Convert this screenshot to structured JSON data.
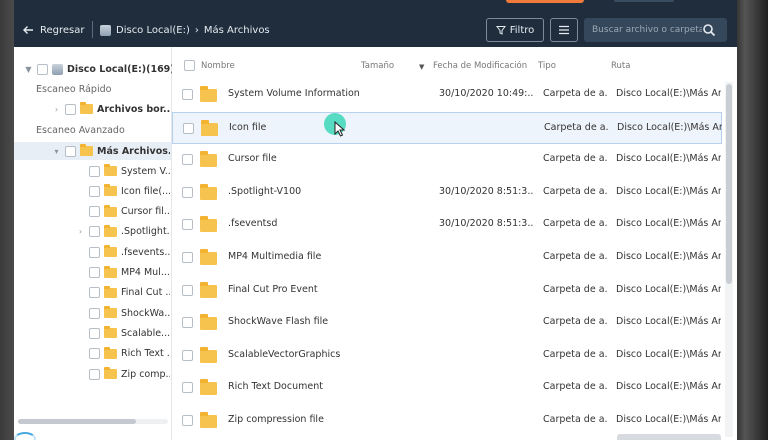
{
  "header": {
    "back_label": "Regresar",
    "breadcrumb": [
      "Disco Local(E:)",
      "Más Archivos"
    ],
    "filter_label": "Filtro",
    "search_placeholder": "Buscar archivo o carpeta"
  },
  "sidebar": {
    "root_label": "Disco Local(E:)(169)",
    "quick_scan_label": "Escaneo Rápido",
    "quick_item": "Archivos bor...",
    "advanced_scan_label": "Escaneo Avanzado",
    "advanced_item": "Más Archivos...",
    "children": [
      "System V...",
      "Icon file(...",
      "Cursor fil...",
      ".Spotlight...",
      ".fsevents...",
      "MP4 Mul...",
      "Final Cut ...",
      "ShockWa...",
      "Scalable...",
      "Rich Text ...",
      "Zip comp..."
    ]
  },
  "table": {
    "columns": {
      "name": "Nombre",
      "size": "Tamaño",
      "date": "Fecha de Modificación",
      "type": "Tipo",
      "path": "Ruta"
    },
    "rows": [
      {
        "name": "System Volume Information",
        "date": "30/10/2020 10:49:...",
        "type": "Carpeta de a...",
        "path": "Disco Local(E:)\\Más Ar..."
      },
      {
        "name": "Icon file",
        "date": "",
        "type": "Carpeta de a...",
        "path": "Disco Local(E:)\\Más Ar..."
      },
      {
        "name": "Cursor file",
        "date": "",
        "type": "Carpeta de a...",
        "path": "Disco Local(E:)\\Más Ar..."
      },
      {
        "name": ".Spotlight-V100",
        "date": "30/10/2020 8:51:3...",
        "type": "Carpeta de a...",
        "path": "Disco Local(E:)\\Más Ar..."
      },
      {
        "name": ".fseventsd",
        "date": "30/10/2020 8:51:3...",
        "type": "Carpeta de a...",
        "path": "Disco Local(E:)\\Más Ar..."
      },
      {
        "name": "MP4 Multimedia file",
        "date": "",
        "type": "Carpeta de a...",
        "path": "Disco Local(E:)\\Más Ar..."
      },
      {
        "name": "Final Cut Pro Event",
        "date": "",
        "type": "Carpeta de a...",
        "path": "Disco Local(E:)\\Más Ar..."
      },
      {
        "name": "ShockWave Flash file",
        "date": "",
        "type": "Carpeta de a...",
        "path": "Disco Local(E:)\\Más Ar..."
      },
      {
        "name": "ScalableVectorGraphics",
        "date": "",
        "type": "Carpeta de a...",
        "path": "Disco Local(E:)\\Más Ar..."
      },
      {
        "name": "Rich Text Document",
        "date": "",
        "type": "Carpeta de a...",
        "path": "Disco Local(E:)\\Más Ar..."
      },
      {
        "name": "Zip compression file",
        "date": "",
        "type": "Carpeta de a...",
        "path": "Disco Local(E:)\\Más Ar..."
      }
    ]
  },
  "colors": {
    "topbar": "#1f2d3d",
    "accent": "#f07a3a",
    "folder": "#f7c34f",
    "cursor_highlight": "#3dd6b8"
  }
}
